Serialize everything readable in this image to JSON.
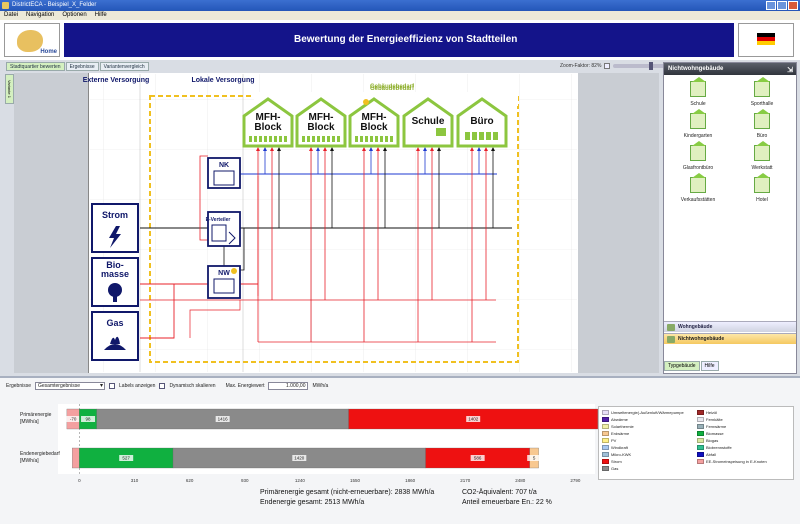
{
  "window": {
    "title": "DistrictECA - Beispiel_X_Felder"
  },
  "menu": [
    "Datei",
    "Navigation",
    "Optionen",
    "Hilfe"
  ],
  "header": {
    "logo_text": "Home",
    "title": "Bewertung der Energieeffizienz von Stadtteilen"
  },
  "tabs": [
    "Stadtquartier bewerten",
    "Ergebnisse",
    "Variantenvergleich"
  ],
  "vertical_tab": "Variante 1",
  "zoom": {
    "label": "Zoom-Faktor: 82%",
    "value": 82
  },
  "diagram": {
    "col_external": "Externe Versorgung",
    "col_local": "Lokale Versorgung",
    "col_demand": "Gebäudebedarf",
    "sources": [
      "Strom",
      "Bio-masse",
      "Gas"
    ],
    "local_units": [
      "NK",
      "E-Verteiler",
      "NW"
    ],
    "buildings": [
      "MFH-Block",
      "MFH-Block",
      "MFH-Block",
      "Schule",
      "Büro"
    ],
    "colors": {
      "heat": "#e8202a",
      "elec": "#111111",
      "cool": "#1e3ad0",
      "building": "#8cc63f",
      "frame": "#f0c020",
      "dark": "#10186a"
    }
  },
  "right_panel": {
    "title": "Nichtwohngebäude",
    "items": [
      {
        "label": "Schule",
        "icon": "school-icon"
      },
      {
        "label": "Sporthalle",
        "icon": "gym-icon"
      },
      {
        "label": "Kindergarten",
        "icon": "kindergarten-icon"
      },
      {
        "label": "Büro",
        "icon": "office-icon"
      },
      {
        "label": "Glasfrontbüro",
        "icon": "glass-office-icon"
      },
      {
        "label": "Werkstatt",
        "icon": "workshop-icon"
      },
      {
        "label": "Verkaufsstätten",
        "icon": "shop-icon"
      },
      {
        "label": "Hotel",
        "icon": "hotel-icon"
      }
    ],
    "categories": [
      "Wohngebäude",
      "Nichtwohngebäude"
    ],
    "bottom_tabs": [
      "Typgebäude",
      "Hilfe"
    ]
  },
  "controls": {
    "result_label": "Ergebnisse",
    "result_value": "Gesamtergebnisse",
    "labels_label": "Labels anzeigen",
    "dyn_label": "Dynamisch skalieren",
    "max_label": "Max. Energiewert",
    "max_value": "1.000,00",
    "unit": "MWh/a"
  },
  "chart_data": {
    "type": "bar",
    "orientation": "horizontal",
    "stacked": true,
    "categories": [
      "Primärenergie [MWh/a]",
      "Endenergiebedarf [MWh/a]"
    ],
    "xlim": [
      -120,
      2900
    ],
    "xticks": [
      0,
      310,
      620,
      930,
      1240,
      1550,
      1860,
      2170,
      2480,
      2790
    ],
    "series": [
      {
        "name": "EE-Stromeinspeisung in E-Knoten",
        "color": "#f4a0a0",
        "values": [
          -70,
          -40
        ],
        "labels": [
          "-70",
          ""
        ]
      },
      {
        "name": "Biomasse",
        "color": "#10b040",
        "values": [
          98,
          527
        ],
        "labels": [
          "98",
          "527"
        ]
      },
      {
        "name": "Gas",
        "color": "#8a8a8a",
        "values": [
          1416,
          1420
        ],
        "labels": [
          "1416",
          "1420"
        ]
      },
      {
        "name": "Strom",
        "color": "#ee1111",
        "values": [
          1402,
          586
        ],
        "labels": [
          "1402",
          "586"
        ]
      },
      {
        "name": "Erdwärme",
        "color": "#f8c890",
        "values": [
          0,
          50
        ],
        "labels": [
          "",
          "5"
        ]
      }
    ]
  },
  "legend": [
    {
      "label": "Umweltenergie(-Außenluft/Wärmepumpe",
      "color": "#e8e0f8"
    },
    {
      "label": "Heizöl",
      "color": "#a02828"
    },
    {
      "label": "Abwärme",
      "color": "#5020a8"
    },
    {
      "label": "Fernkälte",
      "color": "#e8e8f0"
    },
    {
      "label": "Solarthermie",
      "color": "#f0f0a8"
    },
    {
      "label": "Fernwärme",
      "color": "#98b0b8"
    },
    {
      "label": "Erdwärme",
      "color": "#f8c890"
    },
    {
      "label": "Biomasse",
      "color": "#10b040"
    },
    {
      "label": "PV",
      "color": "#fff088"
    },
    {
      "label": "Biogas",
      "color": "#d8e8a0"
    },
    {
      "label": "Windkraft",
      "color": "#a8c8f0"
    },
    {
      "label": "Biobrennstoffe",
      "color": "#30c090"
    },
    {
      "label": "Mikro-KWK",
      "color": "#a0c0d8"
    },
    {
      "label": "Abfall",
      "color": "#1010c0"
    },
    {
      "label": "Strom",
      "color": "#ee1111"
    },
    {
      "label": "EE-Stromeinspeisung in E-Knoten",
      "color": "#f4a0a0"
    },
    {
      "label": "Gas",
      "color": "#8a8a8a"
    }
  ],
  "summary": {
    "primary_total": "Primärenergie gesamt (nicht-erneuerbare): 2838 MWh/a",
    "final_total": "Endenergie gesamt: 2513 MWh/a",
    "co2": "CO2-Äquivalent: 707 t/a",
    "renewable": "Anteil erneuerbare En.: 22 %"
  }
}
